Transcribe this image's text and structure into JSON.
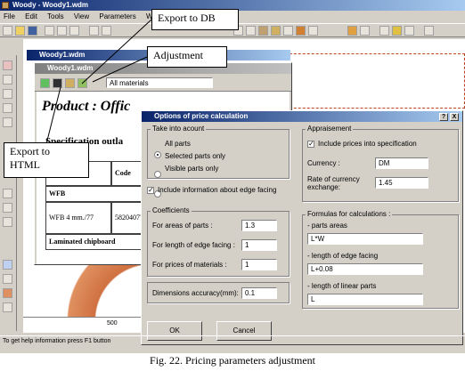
{
  "app": {
    "title": "Woody - Woody1.wdm",
    "menu": [
      "File",
      "Edit",
      "Tools",
      "View",
      "Parameters",
      "Wind"
    ]
  },
  "callouts": {
    "export_db": "Export to DB",
    "adjustment": "Adjustment",
    "export_html": "Export to\nHTML"
  },
  "inner_windows": {
    "back_title": "Woody1.wdm",
    "front_title": "Woody1.wdm",
    "material_filter": "All materials"
  },
  "document": {
    "heading": "Product : Offic",
    "subheading": "Specification outla",
    "table_header_code": "Code",
    "rows": [
      {
        "name": "WFB",
        "code": ""
      },
      {
        "name": "WFB 4 mm./77",
        "code": "58204077"
      },
      {
        "name": "Laminated chipboard",
        "code": ""
      }
    ]
  },
  "ruler": {
    "value": "500"
  },
  "status_bar": "To get help information press F1 button",
  "dialog": {
    "title": "Options of price calculation",
    "take_into_account": {
      "label": "Take into acount",
      "options": [
        "All parts",
        "Selected parts only",
        "Visible parts only"
      ],
      "selected_index": 0
    },
    "include_edge": {
      "label": "Include information about edge facing",
      "checked": true
    },
    "coefficients": {
      "label": "Coefficients",
      "rows": [
        {
          "label": "For areas of parts :",
          "value": "1.3"
        },
        {
          "label": "For length of edge facing :",
          "value": "1"
        },
        {
          "label": "For prices of materials :",
          "value": "1"
        }
      ]
    },
    "dimensions": {
      "label": "Dimensions accuracy(mm):",
      "value": "0.1"
    },
    "appraisement": {
      "label": "Appraisement",
      "include_prices": {
        "label": "Include prices into specification",
        "checked": true
      },
      "currency_label": "Currency :",
      "currency_value": "DM",
      "rate_label": "Rate of currency\nexchange:",
      "rate_value": "1.45"
    },
    "formulas": {
      "label": "Formulas for calculations :",
      "parts_areas_label": "- parts areas",
      "parts_areas_value": "L*W",
      "edge_label": "- length of edge facing",
      "edge_value": "L+0.08",
      "linear_label": "- length of linear parts",
      "linear_value": "L"
    },
    "ok_label": "OK",
    "cancel_label": "Cancel",
    "help_btn": "?",
    "close_btn": "X"
  },
  "caption": "Fig. 22. Pricing parameters adjustment"
}
